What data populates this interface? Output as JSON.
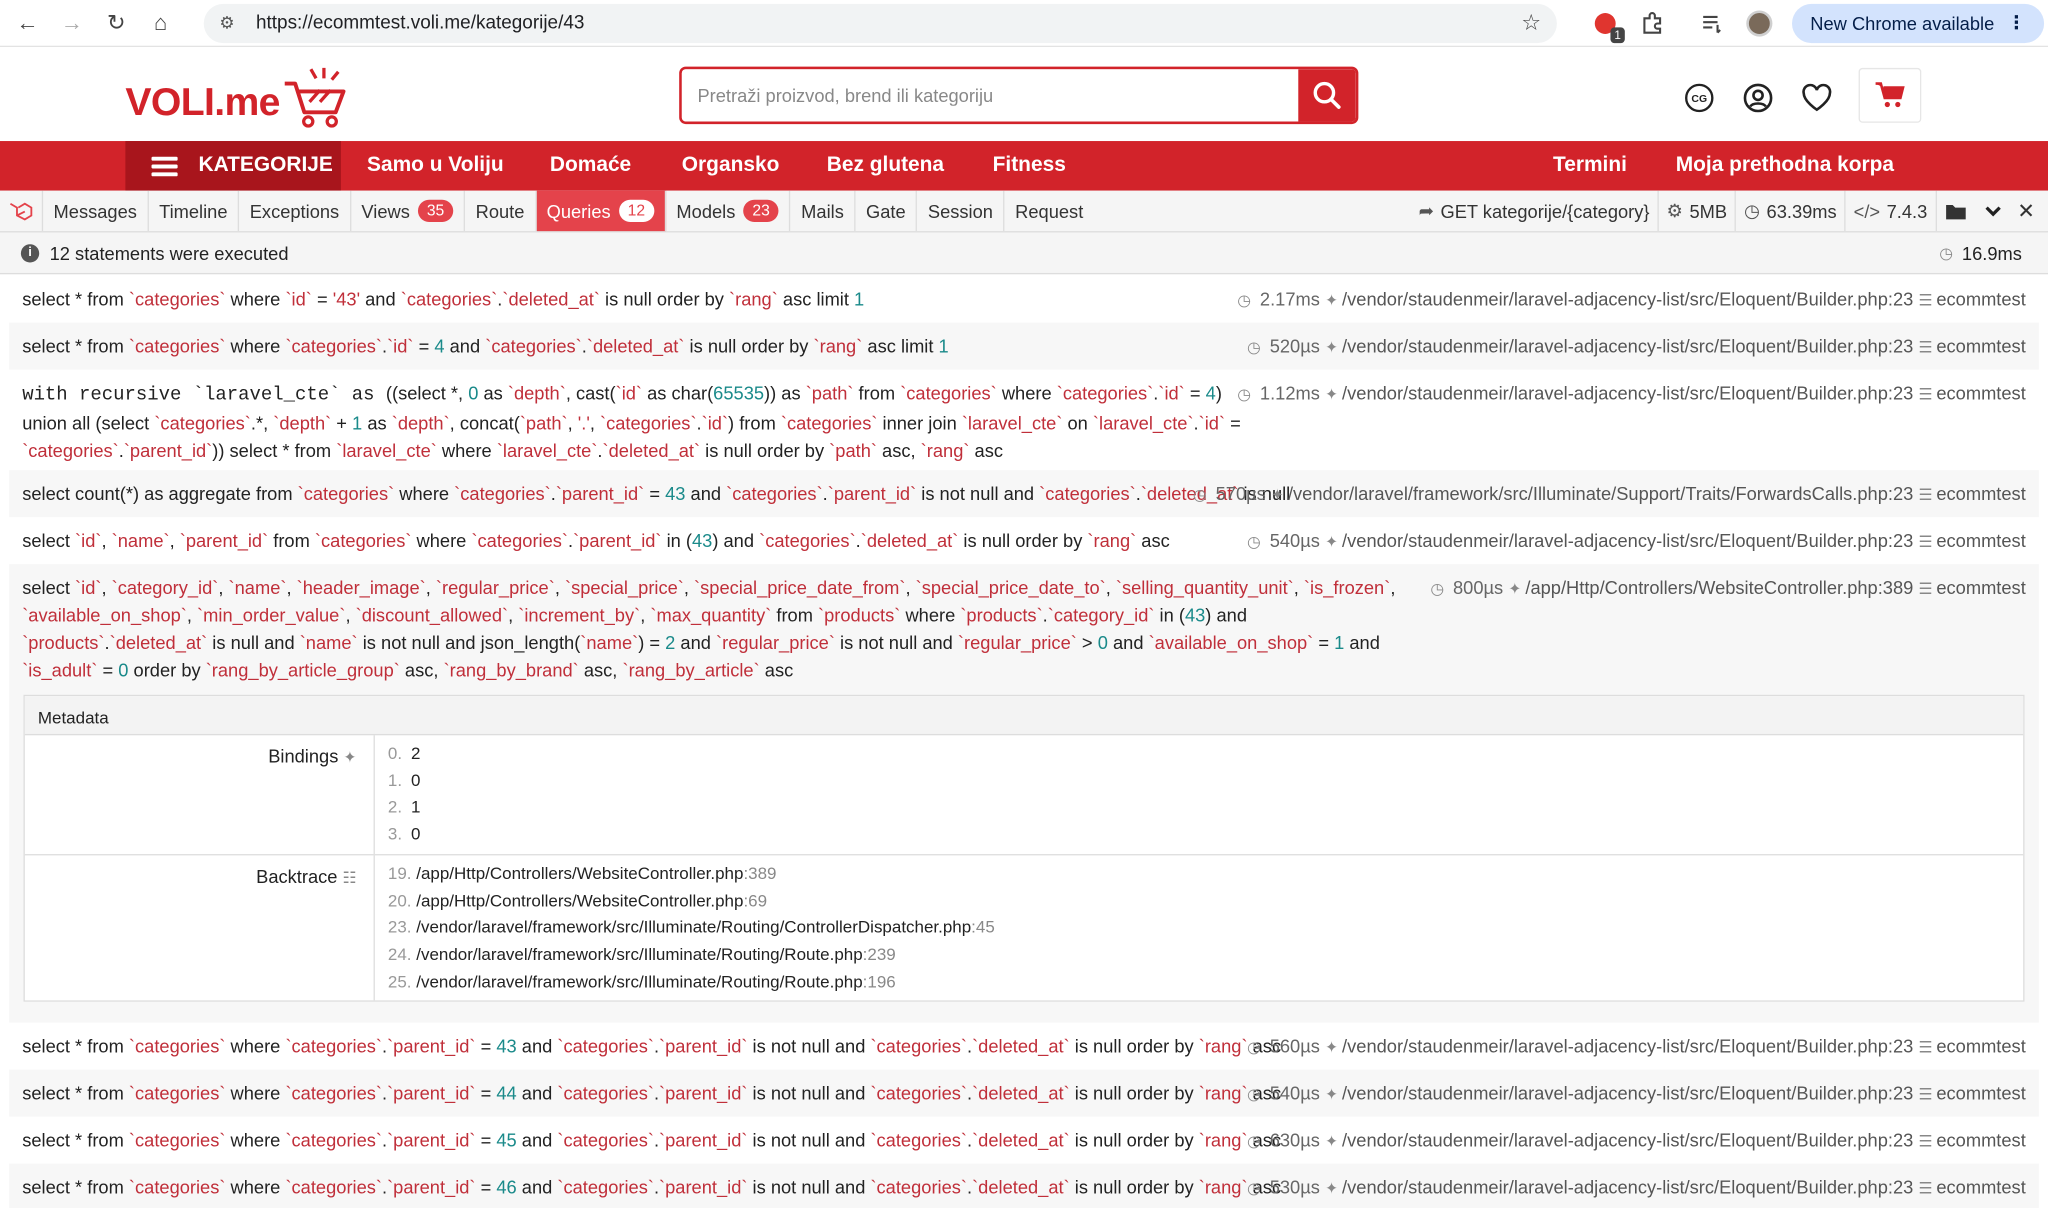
{
  "browser": {
    "url": "https://ecommtest.voli.me/kategorije/43",
    "new_chrome": "New Chrome available",
    "ext_badge": "1"
  },
  "site": {
    "logo": "VOLI.me",
    "search_placeholder": "Pretraži proizvod, brend ili kategoriju",
    "currency_badge": "CG",
    "nav": {
      "categories": "KATEGORIJE",
      "items": [
        "Samo u Voliju",
        "Domaće",
        "Organsko",
        "Bez glutena",
        "Fitness",
        "Termini",
        "Moja prethodna korpa"
      ]
    }
  },
  "debugbar": {
    "tabs": [
      {
        "label": "Messages",
        "count": null
      },
      {
        "label": "Timeline",
        "count": null
      },
      {
        "label": "Exceptions",
        "count": null
      },
      {
        "label": "Views",
        "count": "35"
      },
      {
        "label": "Route",
        "count": null
      },
      {
        "label": "Queries",
        "count": "12"
      },
      {
        "label": "Models",
        "count": "23"
      },
      {
        "label": "Mails",
        "count": null
      },
      {
        "label": "Gate",
        "count": null
      },
      {
        "label": "Session",
        "count": null
      },
      {
        "label": "Request",
        "count": null
      }
    ],
    "route": "GET kategorije/{category}",
    "memory": "5MB",
    "time": "63.39ms",
    "php": "7.4.3",
    "summary": "12 statements were executed",
    "total_time": "16.9ms"
  },
  "queries": {
    "q1_time": "2.17ms",
    "q1_path": "/vendor/staudenmeir/laravel-adjacency-list/src/Eloquent/Builder.php:23",
    "q2_time": "520µs",
    "q2_path": "/vendor/staudenmeir/laravel-adjacency-list/src/Eloquent/Builder.php:23",
    "q3_time": "1.12ms",
    "q3_path": "/vendor/staudenmeir/laravel-adjacency-list/src/Eloquent/Builder.php:23",
    "q4_time": "570µs",
    "q4_path": "/vendor/laravel/framework/src/Illuminate/Support/Traits/ForwardsCalls.php:23",
    "q5_time": "540µs",
    "q5_path": "/vendor/staudenmeir/laravel-adjacency-list/src/Eloquent/Builder.php:23",
    "q6_time": "800µs",
    "q6_path": "/app/Http/Controllers/WebsiteController.php:389",
    "q7_time": "560µs",
    "q7_path": "/vendor/staudenmeir/laravel-adjacency-list/src/Eloquent/Builder.php:23",
    "q8_time": "540µs",
    "q8_path": "/vendor/staudenmeir/laravel-adjacency-list/src/Eloquent/Builder.php:23",
    "q9_time": "630µs",
    "q9_path": "/vendor/staudenmeir/laravel-adjacency-list/src/Eloquent/Builder.php:23",
    "q10_time": "530µs",
    "q10_path": "/vendor/staudenmeir/laravel-adjacency-list/src/Eloquent/Builder.php:23",
    "connection": "ecommtest",
    "q7_parent": "43",
    "q8_parent": "44",
    "q9_parent": "45",
    "q10_parent": "46"
  },
  "metadata": {
    "title": "Metadata",
    "bindings_label": "Bindings",
    "bindings": [
      "2",
      "0",
      "1",
      "0"
    ],
    "backtrace_label": "Backtrace",
    "backtrace": [
      {
        "n": "19.",
        "file": "/app/Http/Controllers/WebsiteController.php",
        "line": ":389"
      },
      {
        "n": "20.",
        "file": "/app/Http/Controllers/WebsiteController.php",
        "line": ":69"
      },
      {
        "n": "23.",
        "file": "/vendor/laravel/framework/src/Illuminate/Routing/ControllerDispatcher.php",
        "line": ":45"
      },
      {
        "n": "24.",
        "file": "/vendor/laravel/framework/src/Illuminate/Routing/Route.php",
        "line": ":239"
      },
      {
        "n": "25.",
        "file": "/vendor/laravel/framework/src/Illuminate/Routing/Route.php",
        "line": ":196"
      }
    ]
  },
  "colors": {
    "brand_red": "#d2232a",
    "dark_red": "#a8151c",
    "debug_red": "#e4434b"
  }
}
